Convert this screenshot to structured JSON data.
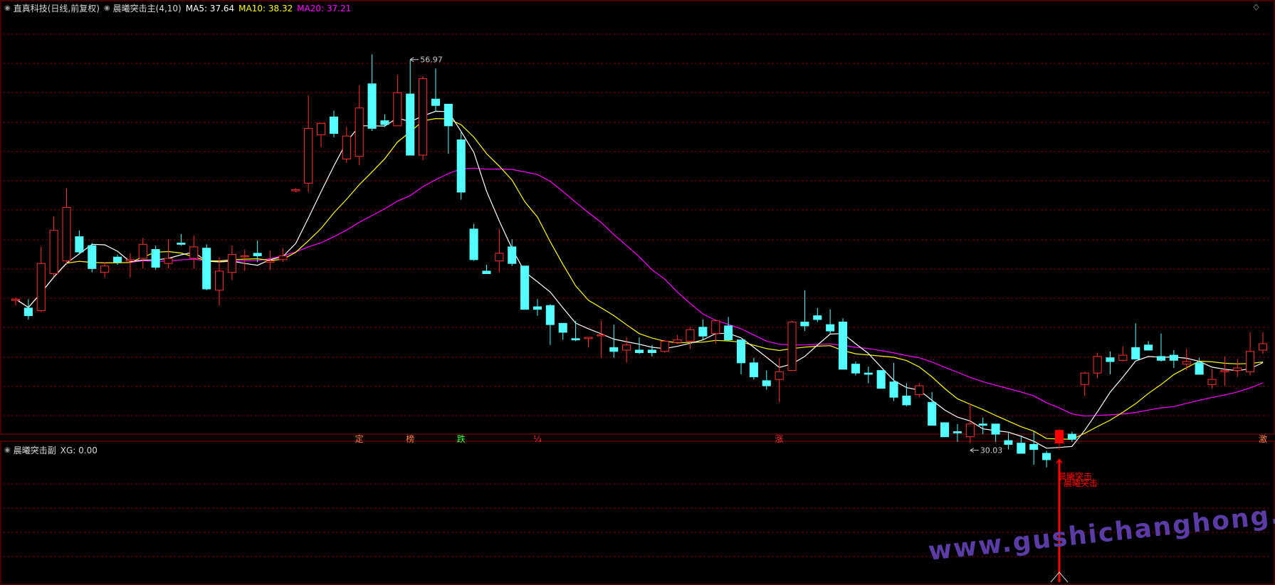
{
  "header": {
    "stock": "直真科技(日线,前复权)",
    "indicator": "晨曦突击主(4,10)",
    "ma5": "MA5: 37.64",
    "ma10": "MA10: 38.32",
    "ma20": "MA20: 37.21"
  },
  "sub_header": {
    "title": "晨曦突击副",
    "xg": "XG: 0.00"
  },
  "watermark": "www.gushichanghong.com",
  "colors": {
    "up": "#ff3030",
    "down": "#54ffff",
    "signal": "#ff0000",
    "ma5": "#ffffff",
    "ma10": "#ffff00",
    "ma20": "#ff00ff",
    "grid": "#7a0000",
    "border": "#8b0000"
  },
  "chart_data": {
    "type": "candlestick",
    "price_range": [
      28.5,
      60
    ],
    "annotations": {
      "max_label": "56.97",
      "max_index": 31,
      "min_label": "30.03",
      "min_index": 75,
      "signal_label": "晨曦突击",
      "signal_index": 82
    },
    "bottom_markers": [
      {
        "index": 27,
        "text": "定",
        "color": "#ff8040"
      },
      {
        "index": 31,
        "text": "榜",
        "color": "#ff8040"
      },
      {
        "index": 35,
        "text": "跌",
        "color": "#40ff40"
      },
      {
        "index": 41,
        "text": "⅓",
        "color": "#ff3030"
      },
      {
        "index": 60,
        "text": "涨",
        "color": "#ff3030"
      },
      {
        "index": 98,
        "text": "激",
        "color": "#ff8040"
      }
    ],
    "candles": [
      [
        38.1,
        38.3,
        37.7,
        38.2
      ],
      [
        37.5,
        38.2,
        36.6,
        36.9
      ],
      [
        37.3,
        42.3,
        37.2,
        41.0
      ],
      [
        40.2,
        44.7,
        40.0,
        43.6
      ],
      [
        41.2,
        46.9,
        40.9,
        45.4
      ],
      [
        43.1,
        43.6,
        41.7,
        41.9
      ],
      [
        42.4,
        42.6,
        40.3,
        40.6
      ],
      [
        40.3,
        41.1,
        39.9,
        40.8
      ],
      [
        41.5,
        41.7,
        40.9,
        41.1
      ],
      [
        41.2,
        41.8,
        39.9,
        41.3
      ],
      [
        41.4,
        43.0,
        40.6,
        42.5
      ],
      [
        42.1,
        42.4,
        40.5,
        40.7
      ],
      [
        41.0,
        42.9,
        40.6,
        41.4
      ],
      [
        42.6,
        43.3,
        42.4,
        42.5
      ],
      [
        41.4,
        43.2,
        40.6,
        42.3
      ],
      [
        42.2,
        42.5,
        38.9,
        39.0
      ],
      [
        38.9,
        41.5,
        37.7,
        40.4
      ],
      [
        40.3,
        42.4,
        39.7,
        41.7
      ],
      [
        41.6,
        42.1,
        40.4,
        41.6
      ],
      [
        41.8,
        42.8,
        41.1,
        41.6
      ],
      [
        41.1,
        42.0,
        40.5,
        41.2
      ],
      [
        41.3,
        42.2,
        41.1,
        41.6
      ],
      [
        46.7,
        46.9,
        46.6,
        46.8
      ],
      [
        47.3,
        54.2,
        46.6,
        51.6
      ],
      [
        51.1,
        52.0,
        50.1,
        52.0
      ],
      [
        52.5,
        53.0,
        50.9,
        51.2
      ],
      [
        49.2,
        51.7,
        48.9,
        51.0
      ],
      [
        49.4,
        55.0,
        48.7,
        53.2
      ],
      [
        55.1,
        57.4,
        51.4,
        51.6
      ],
      [
        52.2,
        52.7,
        51.7,
        51.9
      ],
      [
        51.8,
        55.8,
        51.8,
        54.4
      ],
      [
        54.3,
        57.0,
        52.4,
        49.5
      ],
      [
        49.5,
        55.7,
        49.1,
        55.5
      ],
      [
        53.9,
        56.3,
        52.9,
        53.4
      ],
      [
        53.5,
        52.9,
        49.6,
        51.8
      ],
      [
        50.7,
        51.3,
        46.0,
        46.6
      ],
      [
        43.7,
        44.1,
        41.2,
        41.3
      ],
      [
        40.4,
        40.9,
        40.3,
        40.2
      ],
      [
        41.2,
        43.7,
        40.3,
        41.8
      ],
      [
        42.3,
        42.9,
        40.8,
        41.0
      ],
      [
        40.8,
        40.8,
        37.4,
        37.4
      ],
      [
        37.6,
        38.2,
        36.9,
        37.4
      ],
      [
        37.7,
        37.8,
        34.6,
        36.2
      ],
      [
        36.3,
        36.3,
        35.0,
        35.6
      ],
      [
        35.1,
        36.5,
        34.9,
        35.0
      ],
      [
        35.1,
        35.2,
        34.4,
        35.2
      ],
      [
        35.4,
        36.5,
        33.6,
        35.4
      ],
      [
        34.4,
        36.2,
        33.6,
        34.1
      ],
      [
        34.2,
        35.2,
        33.2,
        34.6
      ],
      [
        34.2,
        35.2,
        33.9,
        34.0
      ],
      [
        34.2,
        34.6,
        33.7,
        34.0
      ],
      [
        34.1,
        35.0,
        34.0,
        34.9
      ],
      [
        34.8,
        35.4,
        34.7,
        35.0
      ],
      [
        34.9,
        36.0,
        34.3,
        35.8
      ],
      [
        36.0,
        36.6,
        35.0,
        35.3
      ],
      [
        35.5,
        36.6,
        34.7,
        36.5
      ],
      [
        36.1,
        36.8,
        34.9,
        35.0
      ],
      [
        35.0,
        34.9,
        32.3,
        33.2
      ],
      [
        33.2,
        33.6,
        31.9,
        32.1
      ],
      [
        31.8,
        32.6,
        31.1,
        31.4
      ],
      [
        31.9,
        33.6,
        30.1,
        32.5
      ],
      [
        32.6,
        36.5,
        32.6,
        36.4
      ],
      [
        36.4,
        38.9,
        35.7,
        36.1
      ],
      [
        36.9,
        37.5,
        36.4,
        36.6
      ],
      [
        36.2,
        37.4,
        35.5,
        35.7
      ],
      [
        36.4,
        36.7,
        32.8,
        32.7
      ],
      [
        33.1,
        33.3,
        32.2,
        32.4
      ],
      [
        32.4,
        32.9,
        31.6,
        32.3
      ],
      [
        32.6,
        32.5,
        31.7,
        31.2
      ],
      [
        31.7,
        33.2,
        30.2,
        30.5
      ],
      [
        30.6,
        31.6,
        29.8,
        29.9
      ],
      [
        30.7,
        31.6,
        30.5,
        31.4
      ],
      [
        30.1,
        30.9,
        28.8,
        28.3
      ],
      [
        28.5,
        28.2,
        27.5,
        27.4
      ],
      [
        27.8,
        28.4,
        27.0,
        27.7
      ],
      [
        27.4,
        30.0,
        26.9,
        28.4
      ],
      [
        28.4,
        28.9,
        27.6,
        28.3
      ],
      [
        28.4,
        28.1,
        27.0,
        27.6
      ],
      [
        27.1,
        27.7,
        26.4,
        26.8
      ],
      [
        26.9,
        27.5,
        26.3,
        26.1
      ],
      [
        26.8,
        27.8,
        25.2,
        26.4
      ],
      [
        26.1,
        26.3,
        25.0,
        25.6
      ],
      [
        26.9,
        28.0,
        26.4,
        27.9
      ],
      [
        27.6,
        27.8,
        27.0,
        27.2
      ],
      [
        31.5,
        32.5,
        30.6,
        32.4
      ],
      [
        32.4,
        34.0,
        32.0,
        33.7
      ],
      [
        33.6,
        34.1,
        32.3,
        33.3
      ],
      [
        33.4,
        34.5,
        33.3,
        33.8
      ],
      [
        34.4,
        36.3,
        33.5,
        33.5
      ],
      [
        34.6,
        34.9,
        34.2,
        34.2
      ],
      [
        33.7,
        35.5,
        33.3,
        33.4
      ],
      [
        33.8,
        34.2,
        32.8,
        33.4
      ],
      [
        33.1,
        34.3,
        32.6,
        33.3
      ],
      [
        33.2,
        33.6,
        32.4,
        32.3
      ],
      [
        31.5,
        32.7,
        31.2,
        31.9
      ],
      [
        32.5,
        33.7,
        31.4,
        32.6
      ],
      [
        32.6,
        33.5,
        32.1,
        32.8
      ],
      [
        32.5,
        35.6,
        32.2,
        34.1
      ],
      [
        34.2,
        35.6,
        33.9,
        34.7
      ]
    ],
    "ma5": [],
    "ma10": [],
    "ma20": [],
    "signal_value": [
      0,
      0,
      0,
      0,
      0,
      0,
      0,
      0,
      0,
      0,
      0,
      0,
      0,
      0,
      0,
      0,
      0,
      0,
      0,
      0,
      0,
      0,
      0,
      0,
      0,
      0,
      0,
      0,
      0,
      0,
      0,
      0,
      0,
      0,
      0,
      0,
      0,
      0,
      0,
      0,
      0,
      0,
      0,
      0,
      0,
      0,
      0,
      0,
      0,
      0,
      0,
      0,
      0,
      0,
      0,
      0,
      0,
      0,
      0,
      0,
      0,
      0,
      0,
      0,
      0,
      0,
      0,
      0,
      0,
      0,
      0,
      0,
      0,
      0,
      0,
      0,
      0,
      0,
      0,
      0,
      0,
      0,
      1,
      0,
      0,
      0,
      0,
      0,
      0,
      0,
      0,
      0,
      0,
      0,
      0,
      0,
      0,
      0,
      0
    ]
  }
}
